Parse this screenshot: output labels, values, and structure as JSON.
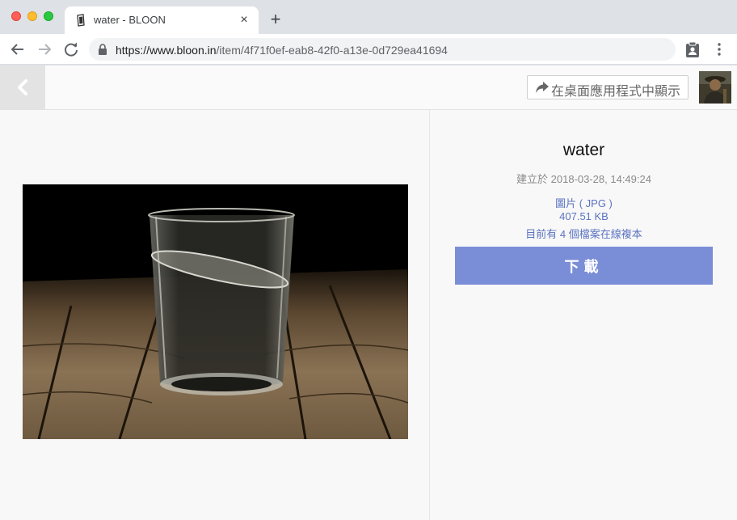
{
  "browser": {
    "tab_title": "water - BLOON",
    "url_host": "https://www.bloon.in",
    "url_path": "/item/4f71f0ef-eab8-42f0-a13e-0d729ea41694"
  },
  "header": {
    "open_in_app_label": "在桌面應用程式中顯示"
  },
  "item": {
    "title": "water",
    "created_label": "建立於 2018-03-28, 14:49:24",
    "file_type": "圖片 ( JPG )",
    "file_size": "407.51 KB",
    "copies_online": "目前有 4 個檔案在線複本",
    "download_label": "下載"
  },
  "icons": {
    "back": "chevron-left-icon",
    "share": "share-arrow-icon",
    "lock": "lock-icon",
    "extension": "clipboard-user-icon",
    "menu": "kebab-menu-icon"
  },
  "colors": {
    "accent": "#7a8ed8",
    "link": "#5b73c0"
  }
}
